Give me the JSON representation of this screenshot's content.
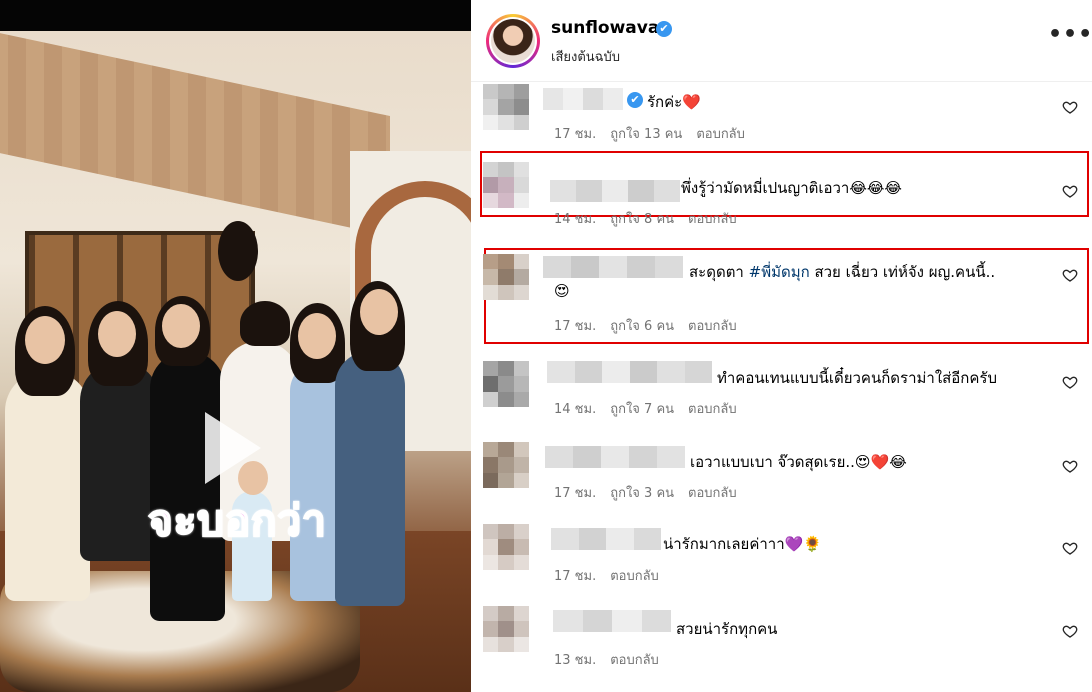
{
  "post": {
    "username": "sunflowava",
    "verified_mark": "✔",
    "audio_label": "เสียงต้นฉบับ",
    "more_label": "•••",
    "video_caption": "จะบอกว่า"
  },
  "icons": {
    "like": "heart-outline-icon",
    "play": "play-icon",
    "verified": "verified-badge-icon"
  },
  "colors": {
    "highlight_box": "#e00000",
    "hashtag": "#00376b",
    "meta": "#737373",
    "caption": "#f26fe0"
  },
  "comments": [
    {
      "text": "รักค่ะ❤️",
      "verified": true,
      "time": "17 ชม.",
      "likes": "ถูกใจ 13 คน",
      "reply": "ตอบกลับ",
      "highlighted": false
    },
    {
      "text": "พึ่งรู้ว่ามัดหมี่เปนญาติเอวา😂😂😂",
      "time": "14 ชม.",
      "likes": "ถูกใจ 8 คน",
      "reply": "ตอบกลับ",
      "highlighted": true
    },
    {
      "text_before": "สะดุดตา ",
      "hashtag": "#พี่มัดมุก",
      "text_after": " สวย เฉี่ยว เท่ห์จัง ผญ.คนนี้..",
      "text_line2": "😍",
      "time": "17 ชม.",
      "likes": "ถูกใจ 6 คน",
      "reply": "ตอบกลับ",
      "highlighted": true
    },
    {
      "text": "ทำคอนเทนแบบนี้เดี๋ยวคนก็ดราม่าใส่อีกครับ",
      "time": "14 ชม.",
      "likes": "ถูกใจ 7 คน",
      "reply": "ตอบกลับ",
      "highlighted": false
    },
    {
      "text": "เอวาแบบเบา จ๊วดสุดเรย..😍❤️😂",
      "time": "17 ชม.",
      "likes": "ถูกใจ 3 คน",
      "reply": "ตอบกลับ",
      "highlighted": false
    },
    {
      "text": "น่ารักมากเลยค่าาา💜🌻",
      "time": "17 ชม.",
      "reply": "ตอบกลับ",
      "highlighted": false
    },
    {
      "text": "สวยน่ารักทุกคน",
      "time": "13 ชม.",
      "reply": "ตอบกลับ",
      "highlighted": false
    }
  ]
}
